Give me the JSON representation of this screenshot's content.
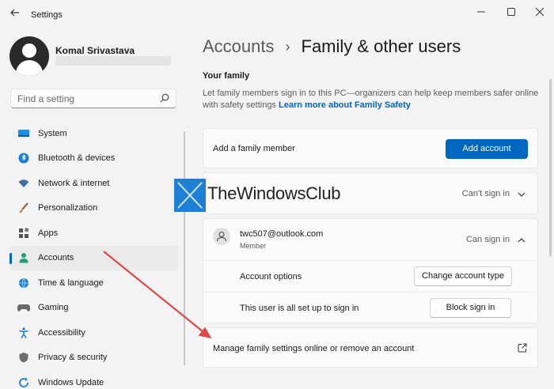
{
  "window": {
    "title": "Settings",
    "controls": [
      "minimize",
      "maximize",
      "close"
    ]
  },
  "profile": {
    "name": "Komal Srivastava"
  },
  "search": {
    "placeholder": "Find a setting"
  },
  "sidebar": {
    "items": [
      {
        "label": "System",
        "icon": "system-icon",
        "color": "#0a84d6"
      },
      {
        "label": "Bluetooth & devices",
        "icon": "bluetooth-icon",
        "color": "#0a84d6"
      },
      {
        "label": "Network & internet",
        "icon": "wifi-icon",
        "color": "#3a6ea5"
      },
      {
        "label": "Personalization",
        "icon": "brush-icon",
        "color": "#b05d23"
      },
      {
        "label": "Apps",
        "icon": "apps-icon",
        "color": "#555555"
      },
      {
        "label": "Accounts",
        "icon": "person-icon",
        "color": "#1e9e7b",
        "active": true
      },
      {
        "label": "Time & language",
        "icon": "globe-icon",
        "color": "#0a84d6"
      },
      {
        "label": "Gaming",
        "icon": "gamepad-icon",
        "color": "#666666"
      },
      {
        "label": "Accessibility",
        "icon": "accessibility-icon",
        "color": "#0a84d6"
      },
      {
        "label": "Privacy & security",
        "icon": "shield-icon",
        "color": "#666666"
      },
      {
        "label": "Windows Update",
        "icon": "update-icon",
        "color": "#0a84d6"
      }
    ]
  },
  "breadcrumb": {
    "parent": "Accounts",
    "separator": "›",
    "current": "Family & other users"
  },
  "section": {
    "title": "Your family",
    "description": "Let family members sign in to this PC—organizers can help keep members safer online with safety settings",
    "link": "Learn more about Family Safety"
  },
  "cards": {
    "add_member": {
      "label": "Add a family member",
      "button": "Add account"
    },
    "hidden_user": {
      "status": "Can't sign in"
    },
    "member": {
      "email": "twc507@outlook.com",
      "role": "Member",
      "status": "Can sign in",
      "options_label": "Account options",
      "options_button": "Change account type",
      "signin_label": "This user is all set up to sign in",
      "signin_button": "Block sign in"
    },
    "manage": {
      "label": "Manage family settings online or remove an account"
    }
  },
  "watermark": {
    "text": "TheWindowsClub"
  },
  "colors": {
    "accent": "#0067c0",
    "annotation_arrow": "#e04848"
  }
}
